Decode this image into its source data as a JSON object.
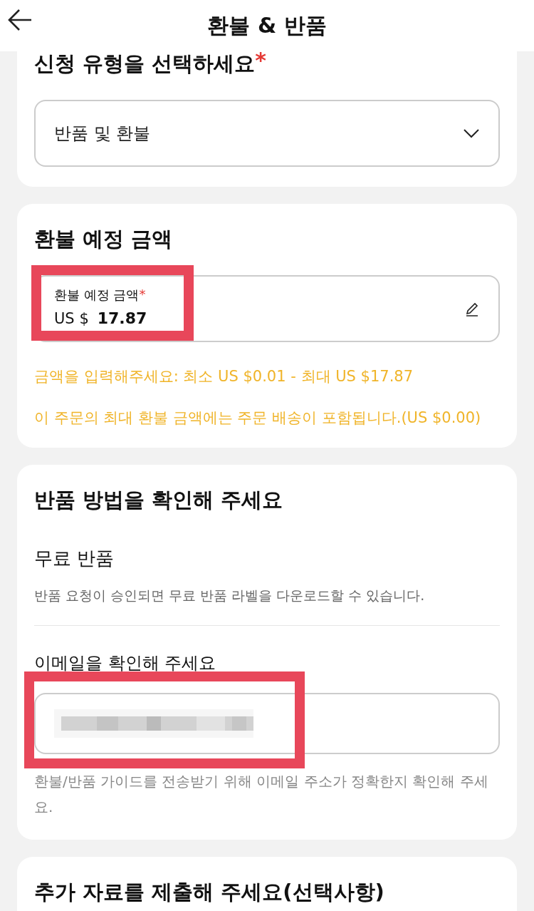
{
  "header": {
    "title": "환불 & 반품"
  },
  "request_type": {
    "heading": "신청 유형을 선택하세요",
    "required_mark": "*",
    "dropdown": {
      "value": "반품 및 환불"
    }
  },
  "refund_amount": {
    "heading": "환불 예정 금액",
    "field": {
      "label": "환불 예정 금액",
      "required_mark": "*",
      "currency": "US $",
      "value": "17.87",
      "highlighted": true
    },
    "notes": [
      "금액을 입력해주세요: 최소 US $0.01 - 최대 US $17.87",
      "이 주문의 최대 환불 금액에는 주문 배송이 포함됩니다.(US $0.00)"
    ]
  },
  "return_method": {
    "heading": "반품 방법을 확인해 주세요",
    "option_title": "무료 반품",
    "option_description": "반품 요청이 승인되면 무료 반품 라벨을 다운로드할 수 있습니다.",
    "email_label": "이메일을 확인해 주세요",
    "email_field": {
      "highlighted": true
    },
    "email_hint": "환불/반품 가이드를 전송받기 위해 이메일 주소가 정확한지 확인해 주세요."
  },
  "additional": {
    "heading": "추가 자료를 제출해 주세요(선택사항)"
  }
}
